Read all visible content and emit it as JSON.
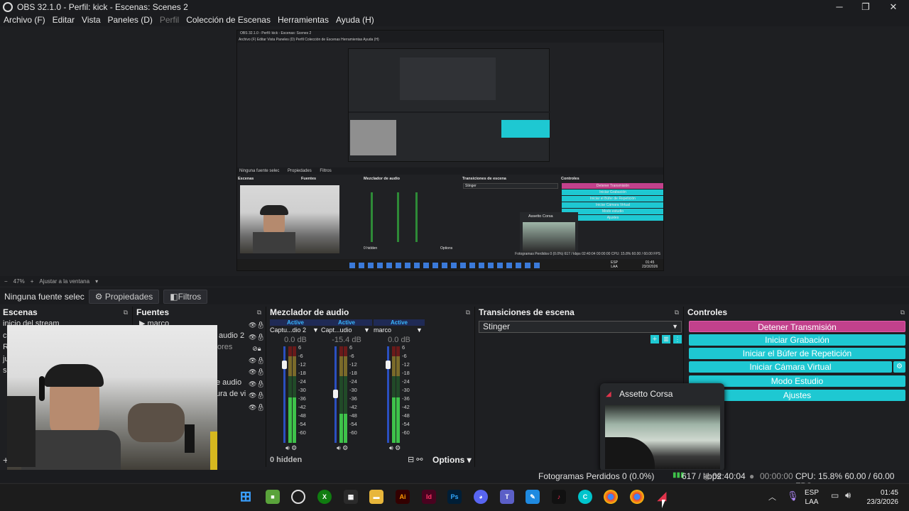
{
  "window": {
    "title": "OBS 32.1.0 - Perfil: kick - Escenas: Scenes 2",
    "controls": {
      "minimize": "─",
      "maximize": "❐",
      "close": "✕"
    }
  },
  "menu": [
    "Archivo (F)",
    "Editar",
    "Vista",
    "Paneles (D)",
    "Perfil",
    "Colección de Escenas",
    "Herramientas",
    "Ayuda (H)"
  ],
  "zoom": {
    "minus": "−",
    "value": "47%",
    "plus": "+",
    "fit_label": "Ajustar a la ventana"
  },
  "context": {
    "no_source": "Ninguna fuente selec",
    "properties": "Propiedades",
    "filters": "Filtros"
  },
  "scenes": {
    "title": "Escenas",
    "items": [
      "inicio del stream",
      "c",
      "R",
      "ju",
      "s"
    ]
  },
  "sources": {
    "title": "Fuentes",
    "items": [
      "marco",
      "audio 2",
      "ores",
      "",
      "",
      "e audio",
      "ura de vi",
      ""
    ]
  },
  "mixer": {
    "title": "Mezclador de audio",
    "channels": [
      {
        "active": "Active",
        "name": "Captu...dio 2",
        "db": "0.0 dB",
        "level": 0.85
      },
      {
        "active": "Active",
        "name": "Capt...udio",
        "db": "-15.4 dB",
        "level": 0.55
      },
      {
        "active": "Active",
        "name": "marco",
        "db": "0.0 dB",
        "level": 0.85
      }
    ],
    "ticks": [
      "6",
      "-6",
      "-12",
      "-18",
      "-24",
      "-30",
      "-36",
      "-42",
      "-48",
      "-54",
      "-60"
    ],
    "hidden": "0 hidden",
    "options": "Options"
  },
  "transitions": {
    "title": "Transiciones de escena",
    "selected": "Stinger"
  },
  "controls": {
    "title": "Controles",
    "buttons": [
      "Detener Transmisión",
      "Iniciar Grabación",
      "Iniciar el Búfer de Repetición",
      "Iniciar Cámara Virtual",
      "Modo Estudio",
      "Ajustes"
    ]
  },
  "popup": {
    "title": "Assetto Corsa"
  },
  "status": {
    "dropped": "Fotogramas Perdidos 0 (0.0%)",
    "kbps": "617 / kbps",
    "stream_time": "02:40:04",
    "rec_time": "00:00:00",
    "cpu": "CPU: 15.8% 60.00 / 60.00 FPS"
  },
  "taskbar": {
    "lang": "ESP",
    "layout": "LAA",
    "time": "01:45",
    "date": "23/3/2026"
  },
  "nested": {
    "title": "OBS 32.1.0 - Perfil: kick - Escenas: Scenes 2",
    "menu": "Archivo (F)  Editar  Vista  Paneles (D)  Perfil  Colección de Escenas  Herramientas  Ayuda (H)",
    "context": "Ninguna fuente selec",
    "properties": "Propiedades",
    "filters": "Filtros",
    "scenes": "Escenas",
    "sources": "Fuentes",
    "mixer": "Mezclador de audio",
    "transitions": "Transiciones de escena",
    "controls": "Controles",
    "stinger": "Stinger",
    "hidden": "0 hidden",
    "options": "Options",
    "status": "Fotogramas Perdidos 0 (0.0%)  617 / kbps  02:40:04  00:00:00  CPU: 15.8% 60.00 / 60.00 FPS",
    "buttons": [
      "Detener Transmisión",
      "Iniciar Grabación",
      "Iniciar el Búfer de Repetición",
      "Iniciar Cámara Virtual",
      "Modo estudio",
      "Ajustes"
    ],
    "popup": "Assetto Corsa",
    "time": "01:45",
    "date": "23/3/2026",
    "lang": "ESP",
    "layout": "LAA"
  },
  "colors": {
    "accent": "#1ec8d2",
    "stop": "#c2418c",
    "bg": "#1e1f22"
  }
}
